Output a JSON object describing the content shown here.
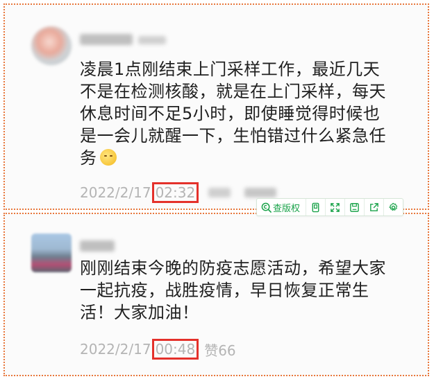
{
  "comments": [
    {
      "text_lines": [
        "凌晨1点刚结束上门采样工作，最近几天",
        "不是在检测核酸，就是在上门采样，每天",
        "休息时间不足5小时，即使睡觉得时候也",
        "是一会儿就醒一下，生怕错过什么紧急任",
        "务"
      ],
      "date": "2022/2/17",
      "time": "02:32"
    },
    {
      "text_lines": [
        "刚刚结束今晚的防疫志愿活动，希望大家",
        "一起抗疫，战胜疫情，早日恢复正常生",
        "活！大家加油！"
      ],
      "date": "2022/2/17",
      "time": "00:48",
      "likes": "赞66"
    }
  ],
  "toolbar": {
    "copyright_label": "查版权",
    "icons": [
      "search-copyright-icon",
      "copy-icon",
      "expand-icon",
      "save-icon",
      "share-icon",
      "settings-icon"
    ]
  },
  "colors": {
    "highlight_box": "#e4312b",
    "card_border": "#e8763a",
    "toolbar_accent": "#1aa34a"
  }
}
